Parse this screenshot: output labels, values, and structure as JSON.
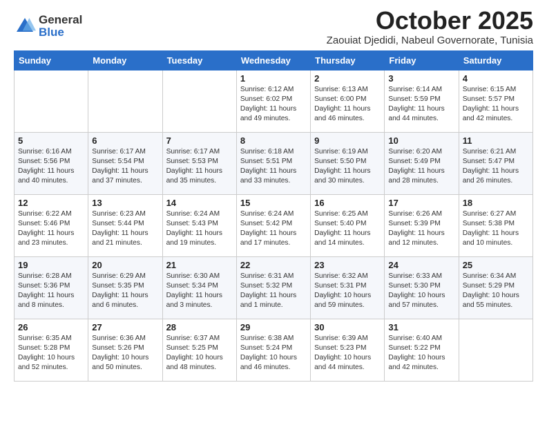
{
  "logo": {
    "general": "General",
    "blue": "Blue"
  },
  "title": "October 2025",
  "location": "Zaouiat Djedidi, Nabeul Governorate, Tunisia",
  "days_of_week": [
    "Sunday",
    "Monday",
    "Tuesday",
    "Wednesday",
    "Thursday",
    "Friday",
    "Saturday"
  ],
  "weeks": [
    [
      {
        "day": "",
        "info": ""
      },
      {
        "day": "",
        "info": ""
      },
      {
        "day": "",
        "info": ""
      },
      {
        "day": "1",
        "info": "Sunrise: 6:12 AM\nSunset: 6:02 PM\nDaylight: 11 hours and 49 minutes."
      },
      {
        "day": "2",
        "info": "Sunrise: 6:13 AM\nSunset: 6:00 PM\nDaylight: 11 hours and 46 minutes."
      },
      {
        "day": "3",
        "info": "Sunrise: 6:14 AM\nSunset: 5:59 PM\nDaylight: 11 hours and 44 minutes."
      },
      {
        "day": "4",
        "info": "Sunrise: 6:15 AM\nSunset: 5:57 PM\nDaylight: 11 hours and 42 minutes."
      }
    ],
    [
      {
        "day": "5",
        "info": "Sunrise: 6:16 AM\nSunset: 5:56 PM\nDaylight: 11 hours and 40 minutes."
      },
      {
        "day": "6",
        "info": "Sunrise: 6:17 AM\nSunset: 5:54 PM\nDaylight: 11 hours and 37 minutes."
      },
      {
        "day": "7",
        "info": "Sunrise: 6:17 AM\nSunset: 5:53 PM\nDaylight: 11 hours and 35 minutes."
      },
      {
        "day": "8",
        "info": "Sunrise: 6:18 AM\nSunset: 5:51 PM\nDaylight: 11 hours and 33 minutes."
      },
      {
        "day": "9",
        "info": "Sunrise: 6:19 AM\nSunset: 5:50 PM\nDaylight: 11 hours and 30 minutes."
      },
      {
        "day": "10",
        "info": "Sunrise: 6:20 AM\nSunset: 5:49 PM\nDaylight: 11 hours and 28 minutes."
      },
      {
        "day": "11",
        "info": "Sunrise: 6:21 AM\nSunset: 5:47 PM\nDaylight: 11 hours and 26 minutes."
      }
    ],
    [
      {
        "day": "12",
        "info": "Sunrise: 6:22 AM\nSunset: 5:46 PM\nDaylight: 11 hours and 23 minutes."
      },
      {
        "day": "13",
        "info": "Sunrise: 6:23 AM\nSunset: 5:44 PM\nDaylight: 11 hours and 21 minutes."
      },
      {
        "day": "14",
        "info": "Sunrise: 6:24 AM\nSunset: 5:43 PM\nDaylight: 11 hours and 19 minutes."
      },
      {
        "day": "15",
        "info": "Sunrise: 6:24 AM\nSunset: 5:42 PM\nDaylight: 11 hours and 17 minutes."
      },
      {
        "day": "16",
        "info": "Sunrise: 6:25 AM\nSunset: 5:40 PM\nDaylight: 11 hours and 14 minutes."
      },
      {
        "day": "17",
        "info": "Sunrise: 6:26 AM\nSunset: 5:39 PM\nDaylight: 11 hours and 12 minutes."
      },
      {
        "day": "18",
        "info": "Sunrise: 6:27 AM\nSunset: 5:38 PM\nDaylight: 11 hours and 10 minutes."
      }
    ],
    [
      {
        "day": "19",
        "info": "Sunrise: 6:28 AM\nSunset: 5:36 PM\nDaylight: 11 hours and 8 minutes."
      },
      {
        "day": "20",
        "info": "Sunrise: 6:29 AM\nSunset: 5:35 PM\nDaylight: 11 hours and 6 minutes."
      },
      {
        "day": "21",
        "info": "Sunrise: 6:30 AM\nSunset: 5:34 PM\nDaylight: 11 hours and 3 minutes."
      },
      {
        "day": "22",
        "info": "Sunrise: 6:31 AM\nSunset: 5:32 PM\nDaylight: 11 hours and 1 minute."
      },
      {
        "day": "23",
        "info": "Sunrise: 6:32 AM\nSunset: 5:31 PM\nDaylight: 10 hours and 59 minutes."
      },
      {
        "day": "24",
        "info": "Sunrise: 6:33 AM\nSunset: 5:30 PM\nDaylight: 10 hours and 57 minutes."
      },
      {
        "day": "25",
        "info": "Sunrise: 6:34 AM\nSunset: 5:29 PM\nDaylight: 10 hours and 55 minutes."
      }
    ],
    [
      {
        "day": "26",
        "info": "Sunrise: 6:35 AM\nSunset: 5:28 PM\nDaylight: 10 hours and 52 minutes."
      },
      {
        "day": "27",
        "info": "Sunrise: 6:36 AM\nSunset: 5:26 PM\nDaylight: 10 hours and 50 minutes."
      },
      {
        "day": "28",
        "info": "Sunrise: 6:37 AM\nSunset: 5:25 PM\nDaylight: 10 hours and 48 minutes."
      },
      {
        "day": "29",
        "info": "Sunrise: 6:38 AM\nSunset: 5:24 PM\nDaylight: 10 hours and 46 minutes."
      },
      {
        "day": "30",
        "info": "Sunrise: 6:39 AM\nSunset: 5:23 PM\nDaylight: 10 hours and 44 minutes."
      },
      {
        "day": "31",
        "info": "Sunrise: 6:40 AM\nSunset: 5:22 PM\nDaylight: 10 hours and 42 minutes."
      },
      {
        "day": "",
        "info": ""
      }
    ]
  ]
}
